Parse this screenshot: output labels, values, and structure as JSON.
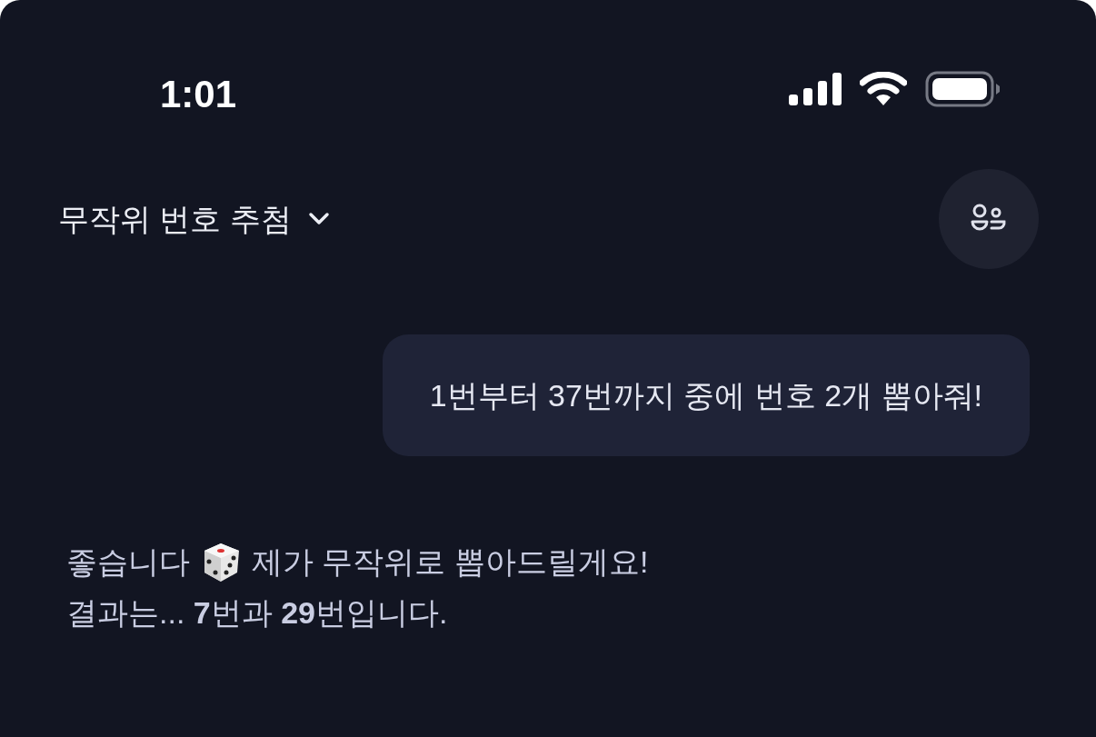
{
  "status_bar": {
    "time": "1:01"
  },
  "header": {
    "title": "무작위 번호 추첨"
  },
  "messages": [
    {
      "kind": "user",
      "text": "1번부터 37번까지 중에 번호 2개 뽑아줘!"
    },
    {
      "kind": "assistant",
      "text_before_icon": "좋습니다",
      "text_after_icon": "제가 무작위로 뽑아드릴게요!",
      "second_line": "결과는... **7**번과 **29**번입니다."
    }
  ]
}
